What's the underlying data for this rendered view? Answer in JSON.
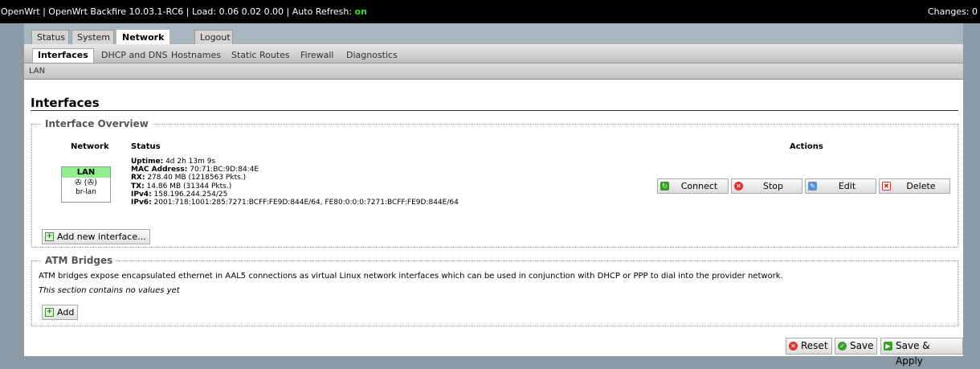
{
  "topbar": {
    "title_prefix": "OpenWrt | OpenWrt Backfire 10.03.1-RC6 | Load: 0.06 0.02 0.00 | Auto Refresh: ",
    "auto_refresh": "on",
    "changes": "Changes: 0"
  },
  "main_tabs": [
    "Status",
    "System",
    "Network",
    "Logout"
  ],
  "sub_tabs": [
    "Interfaces",
    "DHCP and DNS",
    "Hostnames",
    "Static Routes",
    "Firewall",
    "Diagnostics"
  ],
  "third_tab": "LAN",
  "page_title": "Interfaces",
  "overview": {
    "legend": "Interface Overview",
    "headers": {
      "network": "Network",
      "status": "Status",
      "actions": "Actions"
    },
    "interface": {
      "name": "LAN",
      "icons": "✇ (✇)",
      "device": "br-lan",
      "uptime_label": "Uptime:",
      "uptime": " 4d 2h 13m 9s",
      "mac_label": "MAC Address:",
      "mac": " 70:71:BC:9D:84:4E",
      "rx_label": "RX:",
      "rx": " 278.40 MB (1218563 Pkts.)",
      "tx_label": "TX:",
      "tx": " 14.86 MB (31344 Pkts.)",
      "ipv4_label": "IPv4:",
      "ipv4": " 158.196.244.254/25",
      "ipv6_label": "IPv6:",
      "ipv6": " 2001:718:1001:285:7271:BCFF:FE9D:844E/64, FE80:0:0:0:7271:BCFF:FE9D:844E/64"
    },
    "actions": {
      "connect": "Connect",
      "stop": "Stop",
      "edit": "Edit",
      "delete": "Delete"
    },
    "add_interface": "Add new interface..."
  },
  "atm": {
    "legend": "ATM Bridges",
    "description": "ATM bridges expose encapsulated ethernet in AAL5 connections as virtual Linux network interfaces which can be used in conjunction with DHCP or PPP to dial into the provider network.",
    "empty": "This section contains no values yet",
    "add": "Add"
  },
  "footer": {
    "reset": "Reset",
    "save": "Save",
    "save_apply": "Save & Apply"
  }
}
